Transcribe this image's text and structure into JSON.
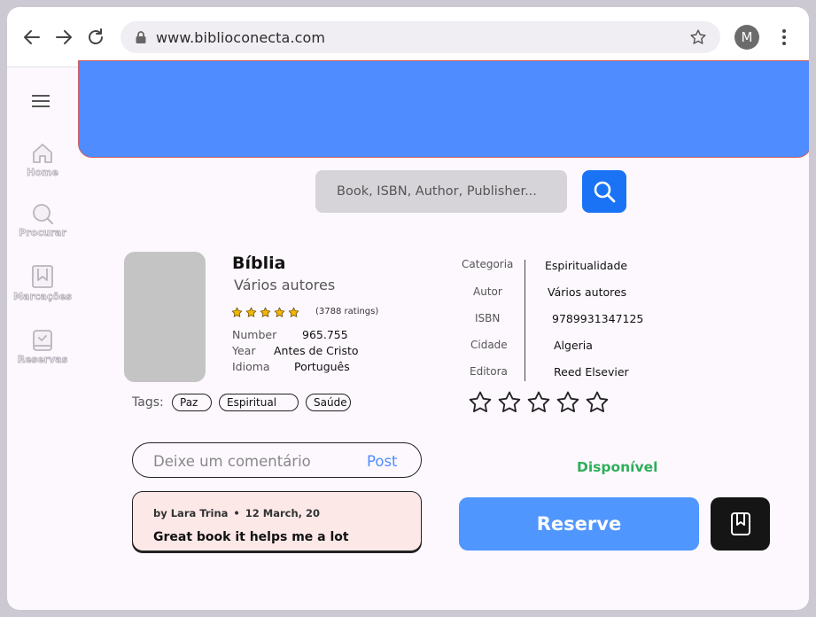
{
  "browser": {
    "url": "www.biblioconecta.com",
    "profile_initial": "M",
    "icons": [
      "back-arrow-icon",
      "forward-arrow-icon",
      "reload-icon",
      "lock-icon",
      "star-icon",
      "kebab-menu-icon"
    ]
  },
  "colors": {
    "banner": "#4f8cff",
    "primary_button": "#4f96fe",
    "search_button": "#1a73f5",
    "available": "#2fae5c",
    "review_card": "#fde8e8"
  },
  "sidebar": {
    "items": [
      {
        "label": "Home",
        "icon": "house-icon"
      },
      {
        "label": "Procurar",
        "icon": "search-icon"
      },
      {
        "label": "Marcações",
        "icon": "bookmark-icon"
      },
      {
        "label": "Reservas",
        "icon": "reserved-book-icon"
      }
    ]
  },
  "search": {
    "placeholder": "Book, ISBN, Author, Publisher..."
  },
  "book": {
    "title": "Bíblia",
    "author": "Vários autores",
    "rating_stars": 5,
    "ratings_count": "(3788 ratings)",
    "meta": [
      {
        "label": "Number",
        "value": "965.755"
      },
      {
        "label": "Year",
        "value": "Antes de Cristo"
      },
      {
        "label": "Idioma",
        "value": "Português"
      }
    ],
    "tags_label": "Tags:",
    "tags": [
      "Paz",
      "Espiritual",
      "Saúde"
    ]
  },
  "details": [
    {
      "label": "Categoria",
      "value": "Espiritualidade"
    },
    {
      "label": "Autor",
      "value": "Vários autores"
    },
    {
      "label": "ISBN",
      "value": "9789931347125"
    },
    {
      "label": "Cidade",
      "value": "Algeria"
    },
    {
      "label": "Editora",
      "value": "Reed Elsevier"
    }
  ],
  "user_rating": {
    "max": 5,
    "value": 0
  },
  "comment": {
    "placeholder": "Deixe um comentário",
    "post_label": "Post"
  },
  "review": {
    "author": "by Lara Trina",
    "date": "12 March, 20",
    "text": "Great book it helps me a lot"
  },
  "status": "Disponível",
  "actions": {
    "reserve_label": "Reserve",
    "bookmark_icon": "bookmark-icon"
  }
}
